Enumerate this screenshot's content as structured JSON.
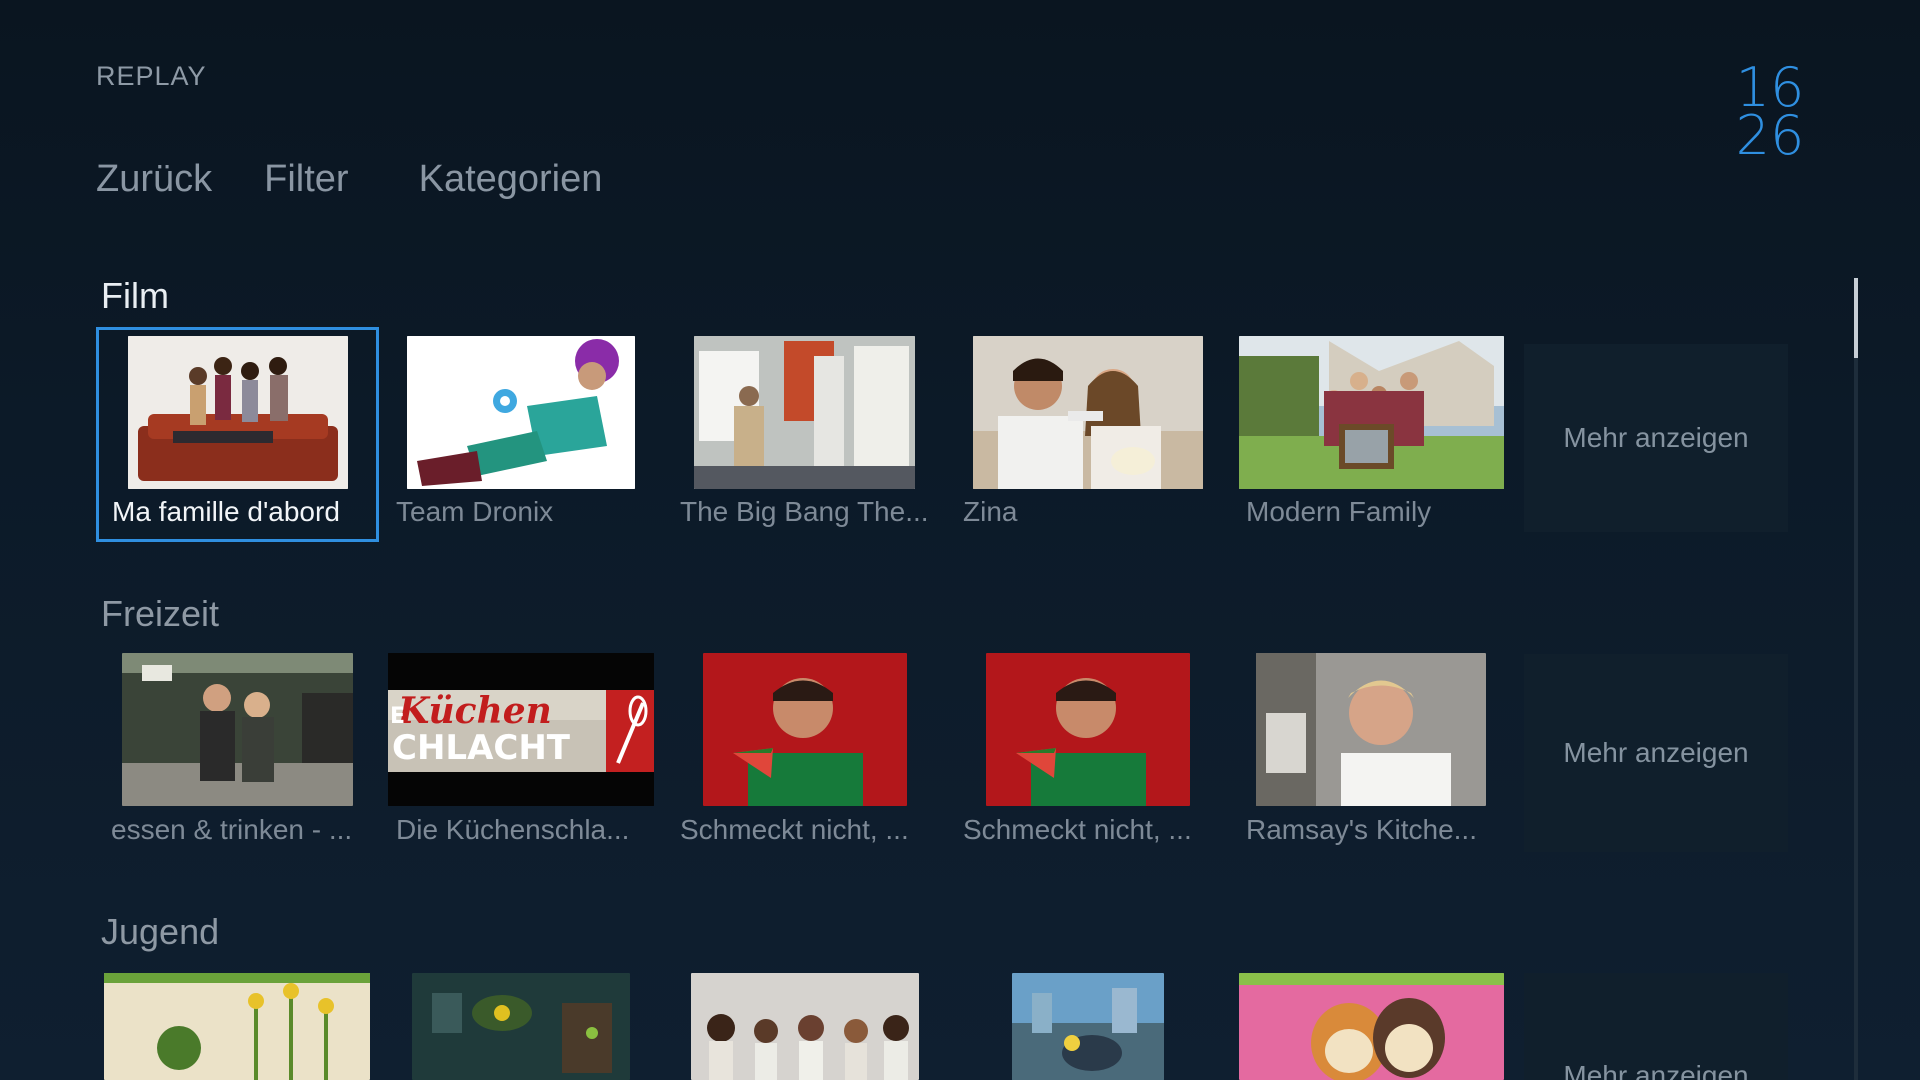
{
  "header": {
    "section": "REPLAY",
    "clock_hour": "16",
    "clock_minute": "26"
  },
  "nav": {
    "back": "Zurück",
    "filter": "Filter",
    "categories": "Kategorien"
  },
  "rows": [
    {
      "title": "Film",
      "items": [
        "Ma famille d'abord",
        "Team Dronix",
        "The Big Bang The...",
        "Zina",
        "Modern Family"
      ],
      "more": "Mehr anzeigen"
    },
    {
      "title": "Freizeit",
      "items": [
        "essen & trinken - ...",
        "Die Küchenschla...",
        "Schmeckt nicht, ...",
        "Schmeckt nicht, ...",
        "Ramsay's Kitche..."
      ],
      "more": "Mehr anzeigen"
    },
    {
      "title": "Jugend",
      "items": [],
      "more": "Mehr anzeigen"
    }
  ],
  "thumbnail_text": {
    "kuechen_line1": "Küchen",
    "kuechen_line2": "CHLACHT",
    "kuechen_prefix": "E"
  },
  "colors": {
    "accent": "#2f8fe0",
    "background": "#0c1a28"
  }
}
